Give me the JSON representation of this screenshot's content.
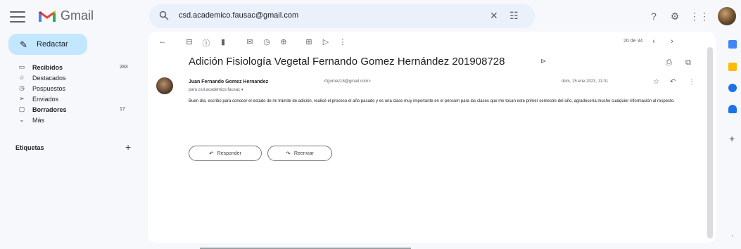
{
  "app": {
    "name": "Gmail"
  },
  "search": {
    "query": "csd.academico.fausac@gmail.com"
  },
  "compose": {
    "label": "Redactar"
  },
  "sidebar": {
    "items": [
      {
        "label": "Recibidos",
        "count": "283",
        "icon": "inbox-icon",
        "bold": true
      },
      {
        "label": "Destacados",
        "count": "",
        "icon": "star-icon",
        "bold": false
      },
      {
        "label": "Pospuestos",
        "count": "",
        "icon": "clock-icon",
        "bold": false
      },
      {
        "label": "Enviados",
        "count": "",
        "icon": "send-icon",
        "bold": false
      },
      {
        "label": "Borradores",
        "count": "17",
        "icon": "draft-icon",
        "bold": true
      },
      {
        "label": "Más",
        "count": "",
        "icon": "chevron-down-icon",
        "bold": false
      }
    ],
    "labels_header": "Etiquetas"
  },
  "toolbar": {
    "page_count": "20 de 34"
  },
  "email": {
    "subject": "Adición Fisiología Vegetal Fernando Gomez Hernández 201908728",
    "sender_name": "Juan Fernando Gomez Hernandez",
    "sender_email": "<fgomez18@gmail.com>",
    "to_line": "para csd.academico.fausac ▾",
    "date": "dom, 15 ene 2023, 11:01",
    "body": "Buen día, escribo para conocer el estado de mi trámite de adición, realicé el proceso el año pasado y es una clase muy importante en el pénsum para las clases que me tocan este primer semestre del año, agradecería mucho cualquier información al respecto.",
    "reply_label": "Responder",
    "forward_label": "Reenviar"
  },
  "colors": {
    "background": "#f6f8fc",
    "compose": "#c2e7ff",
    "search": "#eaf1fb",
    "panel": "#ffffff"
  }
}
